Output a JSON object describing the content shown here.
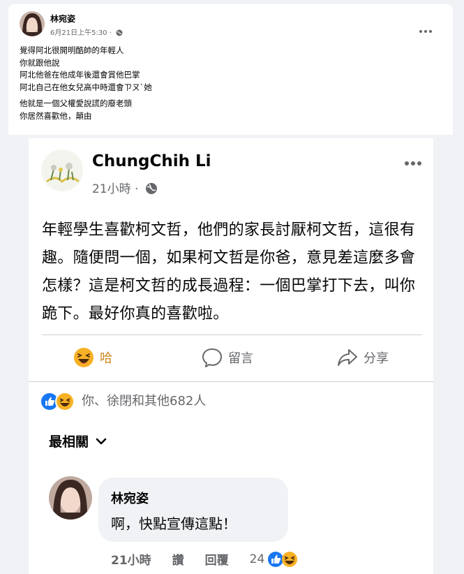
{
  "post": {
    "author": "林宛姿",
    "time": "6月21日上午5:30 ·",
    "lines": [
      "覺得阿北很開明酷帥的年輕人",
      "你就跟他說",
      "阿北他爸在他成年後還會賞他巴掌",
      "阿北自己在他女兒高中時還會ㄗㄡˋ她"
    ],
    "lines2": [
      "他就是一個父權愛說謊的廢老頭",
      "你居然喜歡他，顛由"
    ]
  },
  "shared": {
    "page_name": "ChungChih Li",
    "time": "21小時 ·",
    "text": "年輕學生喜歡柯文哲，他們的家長討厭柯文哲，這很有趣。隨便問一個，如果柯文哲是你爸，意見差這麼多會怎樣？這是柯文哲的成長過程：一個巴掌打下去，叫你跪下。最好你真的喜歡啦。",
    "actions": {
      "haha": "哈",
      "comment": "留言",
      "share": "分享"
    },
    "reactions_text": "你、徐閉和其他682人",
    "sort_label": "最相關"
  },
  "comment": {
    "name": "林宛姿",
    "text": "啊，快點宣傳這點！",
    "time": "21小時",
    "like": "讚",
    "reply": "回覆",
    "count": "24"
  },
  "colors": {
    "like_blue": "#1877f2",
    "haha_yellow": "#f7b125",
    "text_gray": "#65676b"
  }
}
